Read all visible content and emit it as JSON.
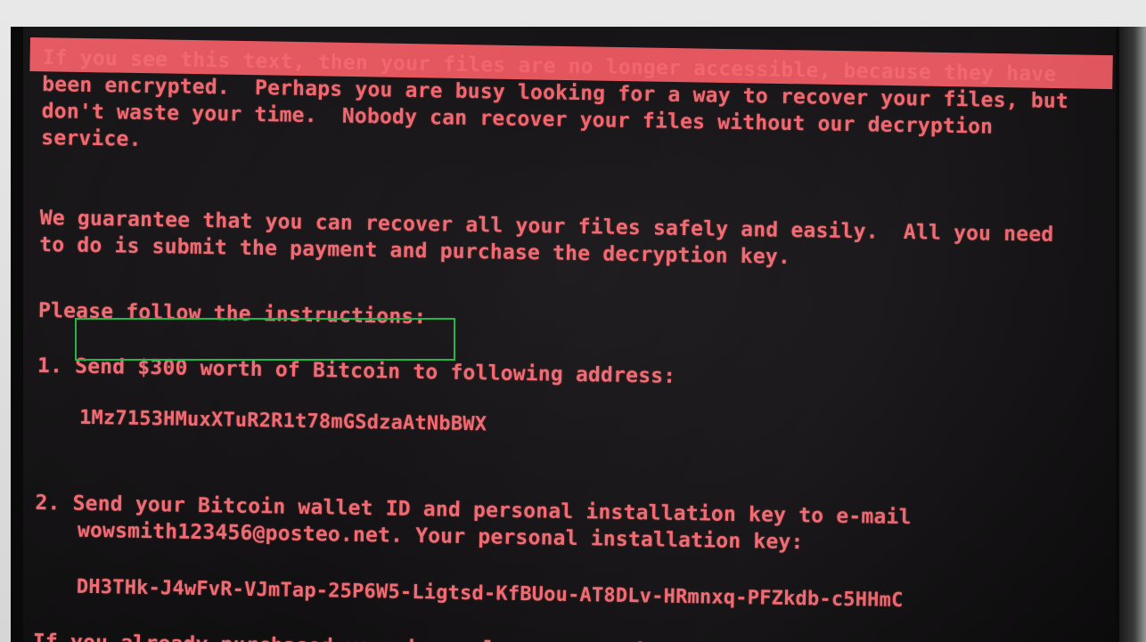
{
  "ransom_note": {
    "paragraph_1": "If you see this text, then your files are no longer accessible, because they have been encrypted.  Perhaps you are busy looking for a way to recover your files, but don't waste your time.  Nobody can recover your files without our decryption service.",
    "paragraph_2": "We guarantee that you can recover all your files safely and easily.  All you need to do is submit the payment and purchase the decryption key.",
    "instructions_heading": "Please follow the instructions:",
    "step_1": "1. Send $300 worth of Bitcoin to following address:",
    "bitcoin_address": "1Mz7153HMuxXTuR2R1t78mGSdzaAtNbBWX",
    "step_2_line_1": "2. Send your Bitcoin wallet ID and personal installation key to e-mail",
    "step_2_line_2": "wowsmith123456@posteo.net. Your personal installation key:",
    "installation_key": "DH3THk-J4wFvR-VJmTap-25P6W5-Ligtsd-KfBUou-AT8DLv-HRmnxq-PFZkdb-c5HHmC",
    "enter_key_prompt": "If you already purchased your key, please enter it below."
  },
  "colors": {
    "text": "#f06a72",
    "header_bar": "#e4565e",
    "highlight": "#1fb84a",
    "screen_bg": "#141214"
  }
}
